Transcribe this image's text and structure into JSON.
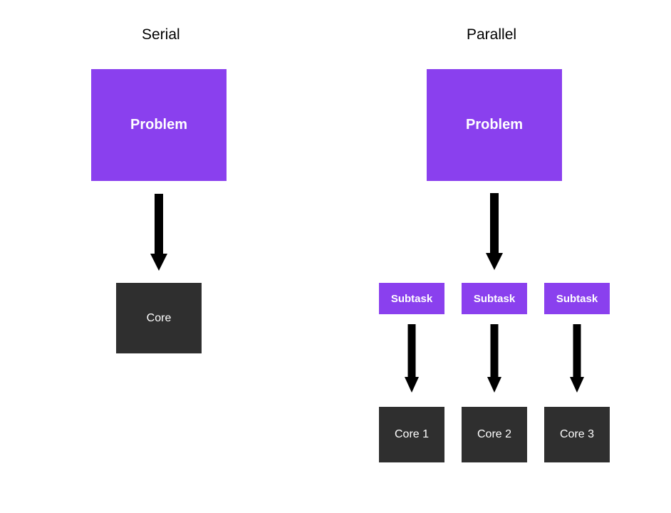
{
  "serial": {
    "heading": "Serial",
    "problem_label": "Problem",
    "core_label": "Core"
  },
  "parallel": {
    "heading": "Parallel",
    "problem_label": "Problem",
    "subtasks": [
      "Subtask",
      "Subtask",
      "Subtask"
    ],
    "cores": [
      "Core 1",
      "Core 2",
      "Core 3"
    ]
  },
  "colors": {
    "problem_bg": "#8a40ee",
    "core_bg": "#2f2f2f",
    "arrow": "#000000",
    "text_light": "#ffffff"
  }
}
